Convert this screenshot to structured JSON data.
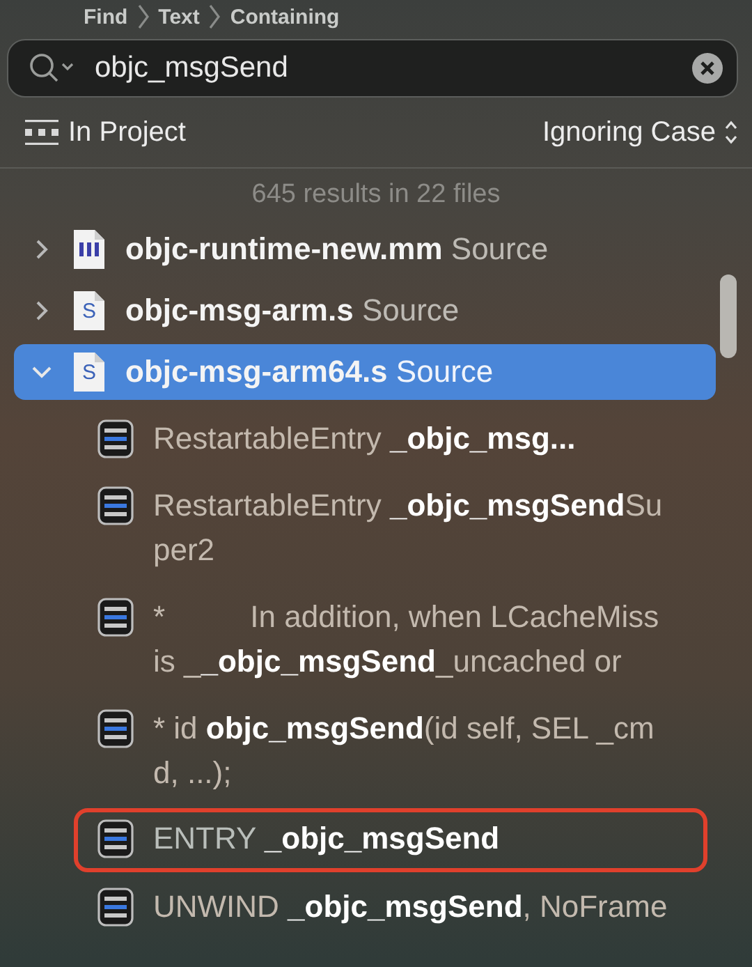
{
  "breadcrumb": [
    "Find",
    "Text",
    "Containing"
  ],
  "search": {
    "value": "objc_msgSend"
  },
  "scope": "In Project",
  "case_option": "Ignoring Case",
  "summary": "645 results in 22 files",
  "files": [
    {
      "kind": "mm",
      "name": "objc-runtime-new.mm",
      "type": "Source",
      "expanded": false,
      "selected": false
    },
    {
      "kind": "asm",
      "badge": "S",
      "name": "objc-msg-arm.s",
      "type": "Source",
      "expanded": false,
      "selected": false
    },
    {
      "kind": "asm",
      "badge": "S",
      "name": "objc-msg-arm64.s",
      "type": "Source",
      "expanded": true,
      "selected": true,
      "matches": [
        {
          "text": "RestartableEntry **_objc_msg...**",
          "annotated": false
        },
        {
          "text": "RestartableEntry **_objc_msgSend**Super2",
          "annotated": false
        },
        {
          "text": "*          In addition, when LCacheMiss is _**_objc_msgSend**_uncached or",
          "annotated": false
        },
        {
          "text": "* id **objc_msgSend**(id self, SEL _cmd, ...);",
          "annotated": false
        },
        {
          "text": "ENTRY **_objc_msgSend**",
          "annotated": true
        },
        {
          "text": "UNWIND **_objc_msgSend**, NoFrame",
          "annotated": false
        }
      ]
    }
  ]
}
